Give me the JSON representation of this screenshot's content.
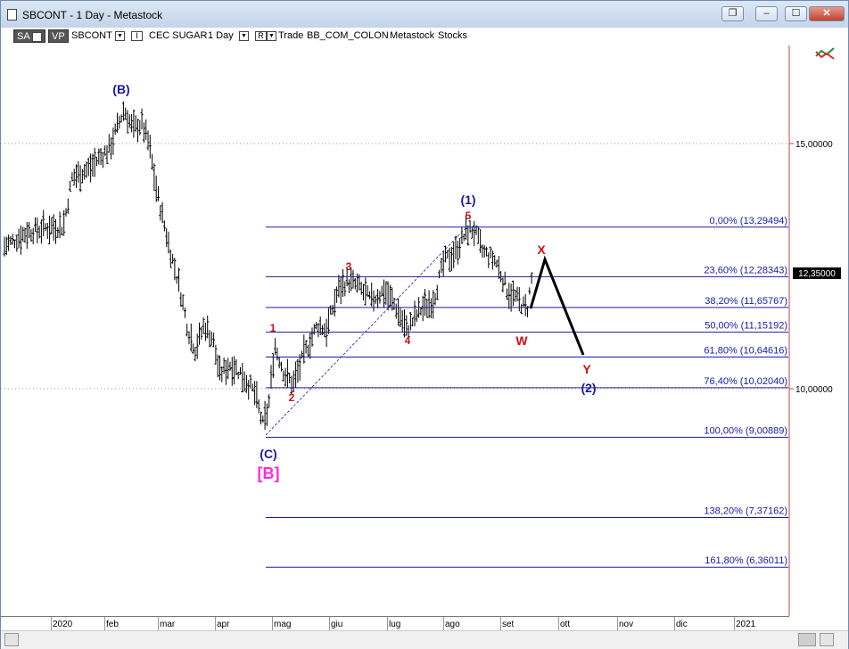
{
  "window": {
    "title": "SBCONT - 1 Day - Metastock",
    "buttons": [
      "restore",
      "minimize",
      "maximize",
      "close"
    ]
  },
  "toolbar": {
    "sa_label": "SA",
    "vp_label": "VP",
    "symbol": "SBCONT",
    "i_label": "I",
    "security_name": "CEC SUGAR",
    "period": "1 Day",
    "r_label": "R",
    "mode": "Trade",
    "source": "BB_COM_COLON",
    "app": "Metastock",
    "type": "Stocks"
  },
  "chart": {
    "price_labels": [
      {
        "text": "15,00000",
        "value": 15.0
      },
      {
        "text": "10,00000",
        "value": 10.0
      }
    ],
    "current_price": "12,35000",
    "x_labels": [
      "2020",
      "feb",
      "mar",
      "apr",
      "mag",
      "giu",
      "lug",
      "ago",
      "set",
      "ott",
      "nov",
      "dic",
      "2021"
    ],
    "fib_levels": [
      {
        "label": "0,00% (13,29494)",
        "value": 13.29494
      },
      {
        "label": "23,60% (12,28343)",
        "value": 12.28343
      },
      {
        "label": "38,20% (11,65767)",
        "value": 11.65767
      },
      {
        "label": "50,00% (11,15192)",
        "value": 11.15192
      },
      {
        "label": "61,80% (10,64616)",
        "value": 10.64616
      },
      {
        "label": "76,40% (10,02040)",
        "value": 10.0204
      },
      {
        "label": "100,00% (9,00889)",
        "value": 9.00889
      },
      {
        "label": "138,20% (7,37162)",
        "value": 7.37162
      },
      {
        "label": "161,80% (6,36011)",
        "value": 6.36011
      }
    ],
    "wave_labels": {
      "B_big": "(B)",
      "C_big": "(C)",
      "B_box": "[B]",
      "one_big": "(1)",
      "two_big": "(2)",
      "w1": "1",
      "w2": "2",
      "w3": "3",
      "w4": "4",
      "w5": "5",
      "W": "W",
      "X": "X",
      "Y": "Y"
    },
    "colors": {
      "fib_line": "#1a1aa6",
      "fib_text": "#1a1aa6",
      "wave_red": "#cc1111",
      "wave_blue": "#1a1aa6",
      "wave_magenta": "#ff2ad4",
      "bars": "#000000",
      "price_axis_line": "#d23c3c"
    }
  }
}
